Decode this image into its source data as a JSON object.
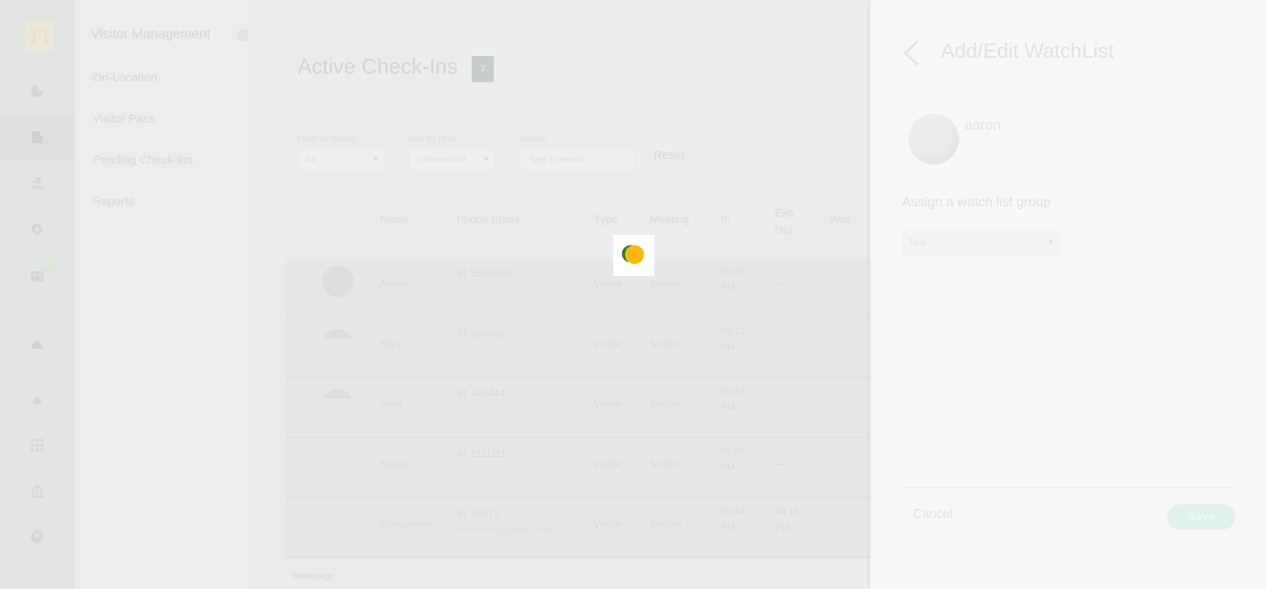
{
  "logo_text": "Fi",
  "sidebar_icons": [
    "dashboard-icon",
    "visitor-icon",
    "add-user-icon",
    "settings-icon",
    "building-icon",
    "alarm-icon",
    "bell-icon",
    "apps-icon",
    "bank-icon",
    "account-icon"
  ],
  "subnav": {
    "header": "Visitor Management",
    "items": [
      "On-Location",
      "Visitor Pass",
      "Pending Check-Ins",
      "Reports"
    ]
  },
  "main": {
    "title": "Active Check-Ins",
    "count": "7",
    "filters": {
      "status_label": "Filter by Status",
      "status_value": "All",
      "host_label": "Sort by Host",
      "host_value": "Choose host",
      "search_label": "Search",
      "search_placeholder": "Type to search",
      "reset": "Reset"
    },
    "columns": [
      "Name",
      "Phone Email",
      "Type",
      "Meeting",
      "In",
      "Exp Out",
      "Wait"
    ],
    "rows": [
      {
        "name": "Aaron",
        "phone": "91 5555555",
        "email": "—",
        "type": "Visitor",
        "meeting": "Sridevi",
        "in": "06:10 PM",
        "exp_out": "—"
      },
      {
        "name": "Hary",
        "phone": "91 666666",
        "email": "—",
        "type": "Visitor",
        "meeting": "Sridevi",
        "in": "06:12 PM",
        "exp_out": ""
      },
      {
        "name": "Srea",
        "phone": "91 444444",
        "email": "—",
        "type": "Visitor",
        "meeting": "Sridevi",
        "in": "05:32 PM",
        "exp_out": ""
      },
      {
        "name": "Sssss",
        "phone": "91 1111111",
        "email": "—",
        "type": "Visitor",
        "meeting": "Sridevi",
        "in": "05:30 PM",
        "exp_out": "—"
      },
      {
        "name": "Ssssssssss",
        "phone": "91 34572",
        "email": "ssssssss@gmail.com",
        "type": "Visitor",
        "meeting": "Sridevi",
        "in": "02:44 PM",
        "exp_out": "04:15 PM"
      }
    ],
    "footer": "Items/page"
  },
  "drawer": {
    "title": "Add/Edit WatchList",
    "person_name": "aaron",
    "assign_label": "Assign a watch list group",
    "group_value": "Test",
    "cancel": "Cancel",
    "save": "Save"
  },
  "colors": {
    "spinner_green": "#2e7d32",
    "spinner_yellow": "#fdb913",
    "save_button": "#dff1e8"
  }
}
